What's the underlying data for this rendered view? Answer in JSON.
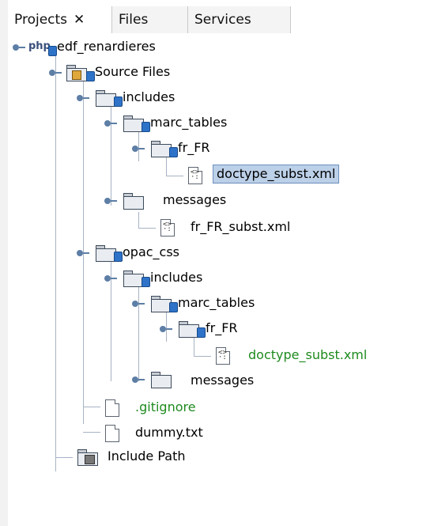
{
  "tabs": [
    {
      "label": "Projects"
    },
    {
      "label": "Files"
    },
    {
      "label": "Services"
    }
  ],
  "tree": {
    "project": {
      "prefix": "php",
      "name": "edf_renardieres"
    },
    "source_files": "Source Files",
    "includes": "includes",
    "marc_tables": "marc_tables",
    "fr_FR": "fr_FR",
    "doctype_1": "doctype_subst.xml",
    "messages": "messages",
    "fr_FR_subst": "fr_FR_subst.xml",
    "opac_css": "opac_css",
    "opac_includes": "includes",
    "opac_marc_tables": "marc_tables",
    "opac_fr_FR": "fr_FR",
    "doctype_2": "doctype_subst.xml",
    "opac_messages": "messages",
    "gitignore": ".gitignore",
    "dummy": "dummy.txt",
    "include_path": "Include Path"
  },
  "colors": {
    "tree_line": "#a7b3c4",
    "selection": "#bcd0e8",
    "green_text": "#1e8a1e"
  }
}
